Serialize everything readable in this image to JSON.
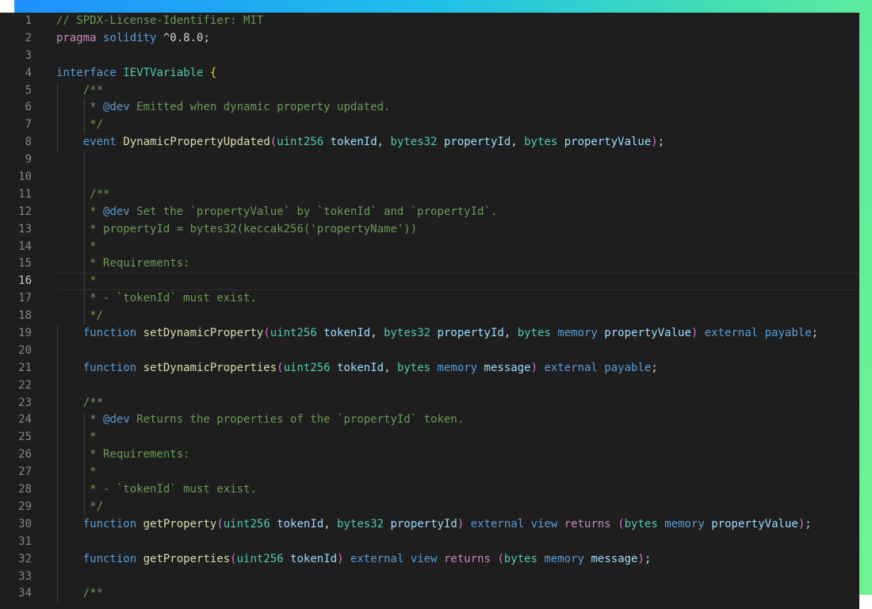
{
  "theme": {
    "background": "#1e1e1e",
    "gutter": "#858585",
    "comment": "#6a9955",
    "keyword": "#569cd6",
    "type": "#4ec9b0",
    "function": "#dcdcaa",
    "parameter": "#9cdcfe",
    "control": "#c586c0"
  },
  "editor": {
    "current_line": 16,
    "lines": [
      {
        "n": "1",
        "t": [
          [
            "cm",
            "// SPDX-License-Identifier: MIT"
          ]
        ]
      },
      {
        "n": "2",
        "t": [
          [
            "ctl",
            "pragma"
          ],
          [
            "pn",
            " "
          ],
          [
            "kw",
            "solidity"
          ],
          [
            "pn",
            " ^0.8.0;"
          ]
        ]
      },
      {
        "n": "3",
        "t": []
      },
      {
        "n": "4",
        "t": [
          [
            "kw",
            "interface"
          ],
          [
            "pn",
            " "
          ],
          [
            "ty",
            "IEVTVariable"
          ],
          [
            "pn",
            " "
          ],
          [
            "br1",
            "{"
          ]
        ]
      },
      {
        "n": "5",
        "t": [
          [
            "pn",
            "    "
          ],
          [
            "cm",
            "/**"
          ]
        ]
      },
      {
        "n": "6",
        "t": [
          [
            "pn",
            "     "
          ],
          [
            "cm",
            "* "
          ],
          [
            "tg",
            "@dev"
          ],
          [
            "cm",
            " Emitted when dynamic property updated."
          ]
        ]
      },
      {
        "n": "7",
        "t": [
          [
            "pn",
            "     "
          ],
          [
            "cm",
            "*/"
          ]
        ]
      },
      {
        "n": "8",
        "t": [
          [
            "pn",
            "    "
          ],
          [
            "kw",
            "event"
          ],
          [
            "pn",
            " "
          ],
          [
            "fn",
            "DynamicPropertyUpdated"
          ],
          [
            "br2",
            "("
          ],
          [
            "ty",
            "uint256"
          ],
          [
            "pn",
            " "
          ],
          [
            "pr",
            "tokenId"
          ],
          [
            "pn",
            ", "
          ],
          [
            "ty",
            "bytes32"
          ],
          [
            "pn",
            " "
          ],
          [
            "pr",
            "propertyId"
          ],
          [
            "pn",
            ", "
          ],
          [
            "ty",
            "bytes"
          ],
          [
            "pn",
            " "
          ],
          [
            "pr",
            "propertyValue"
          ],
          [
            "br2",
            ")"
          ],
          [
            "pn",
            ";"
          ]
        ]
      },
      {
        "n": "9",
        "t": []
      },
      {
        "n": "10",
        "t": []
      },
      {
        "n": "11",
        "t": [
          [
            "pn",
            "     "
          ],
          [
            "cm",
            "/**"
          ]
        ]
      },
      {
        "n": "12",
        "t": [
          [
            "pn",
            "     "
          ],
          [
            "cm",
            "* "
          ],
          [
            "tg",
            "@dev"
          ],
          [
            "cm",
            " Set the `propertyValue` by `tokenId` and `propertyId`."
          ]
        ]
      },
      {
        "n": "13",
        "t": [
          [
            "pn",
            "     "
          ],
          [
            "cm",
            "* propertyId = bytes32(keccak256('propertyName'))"
          ]
        ]
      },
      {
        "n": "14",
        "t": [
          [
            "pn",
            "     "
          ],
          [
            "cm",
            "*"
          ]
        ]
      },
      {
        "n": "15",
        "t": [
          [
            "pn",
            "     "
          ],
          [
            "cm",
            "* Requirements:"
          ]
        ]
      },
      {
        "n": "16",
        "t": [
          [
            "pn",
            "     "
          ],
          [
            "cm",
            "*"
          ]
        ]
      },
      {
        "n": "17",
        "t": [
          [
            "pn",
            "     "
          ],
          [
            "cm",
            "* - `tokenId` must exist."
          ]
        ]
      },
      {
        "n": "18",
        "t": [
          [
            "pn",
            "     "
          ],
          [
            "cm",
            "*/"
          ]
        ]
      },
      {
        "n": "19",
        "t": [
          [
            "pn",
            "    "
          ],
          [
            "kw",
            "function"
          ],
          [
            "pn",
            " "
          ],
          [
            "fn",
            "setDynamicProperty"
          ],
          [
            "br2",
            "("
          ],
          [
            "ty",
            "uint256"
          ],
          [
            "pn",
            " "
          ],
          [
            "pr",
            "tokenId"
          ],
          [
            "pn",
            ", "
          ],
          [
            "ty",
            "bytes32"
          ],
          [
            "pn",
            " "
          ],
          [
            "pr",
            "propertyId"
          ],
          [
            "pn",
            ", "
          ],
          [
            "ty",
            "bytes"
          ],
          [
            "pn",
            " "
          ],
          [
            "kw",
            "memory"
          ],
          [
            "pn",
            " "
          ],
          [
            "pr",
            "propertyValue"
          ],
          [
            "br2",
            ")"
          ],
          [
            "pn",
            " "
          ],
          [
            "kw",
            "external"
          ],
          [
            "pn",
            " "
          ],
          [
            "kw",
            "payable"
          ],
          [
            "pn",
            ";"
          ]
        ]
      },
      {
        "n": "20",
        "t": []
      },
      {
        "n": "21",
        "t": [
          [
            "pn",
            "    "
          ],
          [
            "kw",
            "function"
          ],
          [
            "pn",
            " "
          ],
          [
            "fn",
            "setDynamicProperties"
          ],
          [
            "br2",
            "("
          ],
          [
            "ty",
            "uint256"
          ],
          [
            "pn",
            " "
          ],
          [
            "pr",
            "tokenId"
          ],
          [
            "pn",
            ", "
          ],
          [
            "ty",
            "bytes"
          ],
          [
            "pn",
            " "
          ],
          [
            "kw",
            "memory"
          ],
          [
            "pn",
            " "
          ],
          [
            "pr",
            "message"
          ],
          [
            "br2",
            ")"
          ],
          [
            "pn",
            " "
          ],
          [
            "kw",
            "external"
          ],
          [
            "pn",
            " "
          ],
          [
            "kw",
            "payable"
          ],
          [
            "pn",
            ";"
          ]
        ]
      },
      {
        "n": "22",
        "t": []
      },
      {
        "n": "23",
        "t": [
          [
            "pn",
            "    "
          ],
          [
            "cm",
            "/**"
          ]
        ]
      },
      {
        "n": "24",
        "t": [
          [
            "pn",
            "     "
          ],
          [
            "cm",
            "* "
          ],
          [
            "tg",
            "@dev"
          ],
          [
            "cm",
            " Returns the properties of the `propertyId` token."
          ]
        ]
      },
      {
        "n": "25",
        "t": [
          [
            "pn",
            "     "
          ],
          [
            "cm",
            "*"
          ]
        ]
      },
      {
        "n": "26",
        "t": [
          [
            "pn",
            "     "
          ],
          [
            "cm",
            "* Requirements:"
          ]
        ]
      },
      {
        "n": "27",
        "t": [
          [
            "pn",
            "     "
          ],
          [
            "cm",
            "*"
          ]
        ]
      },
      {
        "n": "28",
        "t": [
          [
            "pn",
            "     "
          ],
          [
            "cm",
            "* - `tokenId` must exist."
          ]
        ]
      },
      {
        "n": "29",
        "t": [
          [
            "pn",
            "     "
          ],
          [
            "cm",
            "*/"
          ]
        ]
      },
      {
        "n": "30",
        "t": [
          [
            "pn",
            "    "
          ],
          [
            "kw",
            "function"
          ],
          [
            "pn",
            " "
          ],
          [
            "fn",
            "getProperty"
          ],
          [
            "br2",
            "("
          ],
          [
            "ty",
            "uint256"
          ],
          [
            "pn",
            " "
          ],
          [
            "pr",
            "tokenId"
          ],
          [
            "pn",
            ", "
          ],
          [
            "ty",
            "bytes32"
          ],
          [
            "pn",
            " "
          ],
          [
            "pr",
            "propertyId"
          ],
          [
            "br2",
            ")"
          ],
          [
            "pn",
            " "
          ],
          [
            "kw",
            "external"
          ],
          [
            "pn",
            " "
          ],
          [
            "kw",
            "view"
          ],
          [
            "pn",
            " "
          ],
          [
            "ctl",
            "returns"
          ],
          [
            "pn",
            " "
          ],
          [
            "br2",
            "("
          ],
          [
            "ty",
            "bytes"
          ],
          [
            "pn",
            " "
          ],
          [
            "kw",
            "memory"
          ],
          [
            "pn",
            " "
          ],
          [
            "pr",
            "propertyValue"
          ],
          [
            "br2",
            ")"
          ],
          [
            "pn",
            ";"
          ]
        ]
      },
      {
        "n": "31",
        "t": []
      },
      {
        "n": "32",
        "t": [
          [
            "pn",
            "    "
          ],
          [
            "kw",
            "function"
          ],
          [
            "pn",
            " "
          ],
          [
            "fn",
            "getProperties"
          ],
          [
            "br2",
            "("
          ],
          [
            "ty",
            "uint256"
          ],
          [
            "pn",
            " "
          ],
          [
            "pr",
            "tokenId"
          ],
          [
            "br2",
            ")"
          ],
          [
            "pn",
            " "
          ],
          [
            "kw",
            "external"
          ],
          [
            "pn",
            " "
          ],
          [
            "kw",
            "view"
          ],
          [
            "pn",
            " "
          ],
          [
            "ctl",
            "returns"
          ],
          [
            "pn",
            " "
          ],
          [
            "br2",
            "("
          ],
          [
            "ty",
            "bytes"
          ],
          [
            "pn",
            " "
          ],
          [
            "kw",
            "memory"
          ],
          [
            "pn",
            " "
          ],
          [
            "pr",
            "message"
          ],
          [
            "br2",
            ")"
          ],
          [
            "pn",
            ";"
          ]
        ]
      },
      {
        "n": "33",
        "t": []
      },
      {
        "n": "34",
        "t": [
          [
            "pn",
            "    "
          ],
          [
            "cm",
            "/**"
          ]
        ]
      }
    ]
  }
}
